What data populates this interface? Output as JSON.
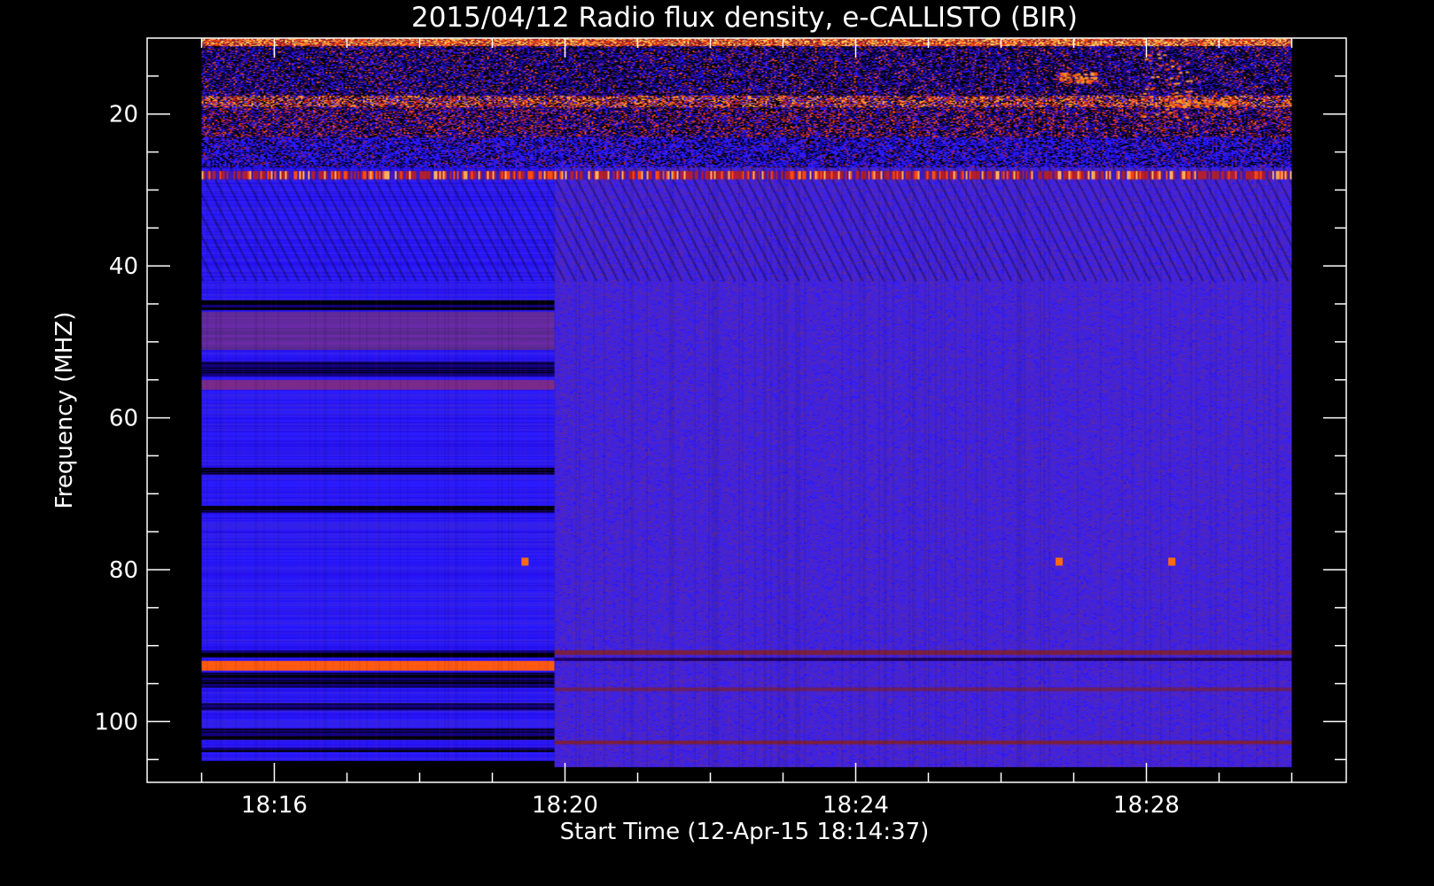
{
  "chart_data": {
    "type": "heatmap",
    "title": "2015/04/12  Radio flux density, e-CALLISTO (BIR)",
    "xlabel": "Start Time (12-Apr-15 18:14:37)",
    "ylabel": "Frequency (MHZ)",
    "x_ticks": [
      "18:16",
      "18:20",
      "18:24",
      "18:28"
    ],
    "x_tick_minutes": [
      16,
      20,
      24,
      28
    ],
    "x_range_minutes": [
      14.25,
      30.75
    ],
    "data_time_range_minutes": [
      15,
      30
    ],
    "y_ticks": [
      20,
      40,
      60,
      80,
      100
    ],
    "y_minor_ticks": [
      15,
      25,
      30,
      35,
      45,
      50,
      55,
      65,
      70,
      75,
      85,
      90,
      95,
      105
    ],
    "y_range": [
      10,
      108
    ],
    "y_inverted": true,
    "data_freq_range_mhz": [
      10,
      106
    ],
    "segment_break_minute": 19.85,
    "grid": false,
    "colormap": [
      "#000000",
      "#1a00a0",
      "#2a1bff",
      "#6a2aa8",
      "#b01f30",
      "#ff4a10",
      "#ff9a30",
      "#ffd060"
    ],
    "features": [
      {
        "label": "rfi-band-top",
        "freq_range": [
          10,
          27
        ]
      },
      {
        "label": "rfi-line",
        "freq": 28
      },
      {
        "label": "bright-line",
        "freq": 92.5,
        "time_range": [
          15,
          19.85
        ]
      },
      {
        "label": "spot",
        "freq": 79,
        "time": 19.45
      },
      {
        "label": "spot",
        "freq": 79,
        "time": 26.8
      },
      {
        "label": "spot",
        "freq": 79,
        "time": 28.35
      }
    ]
  }
}
